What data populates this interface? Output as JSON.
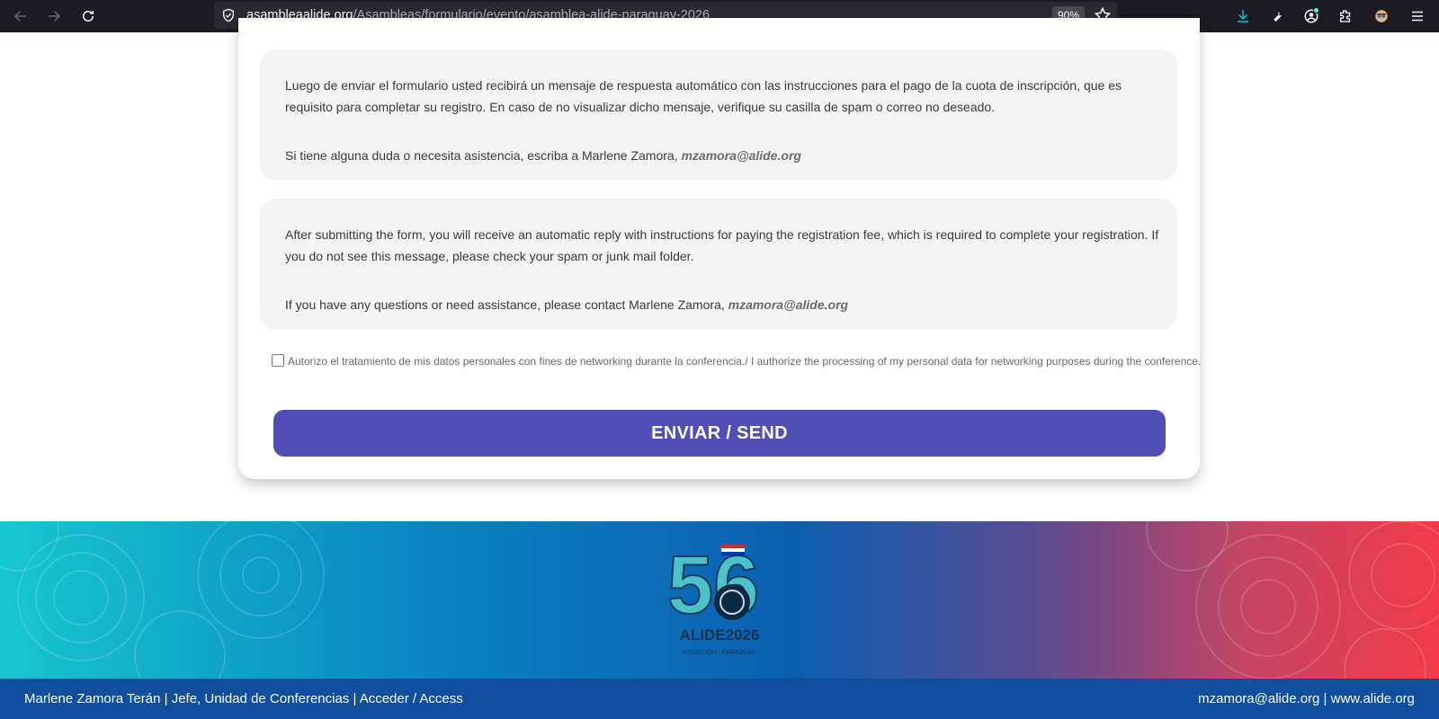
{
  "browser": {
    "url_domain": "asambleaalide.org",
    "url_path": "/Asambleas/formulario/evento/asamblea-alide-paraguay-2026",
    "zoom": "90%"
  },
  "form": {
    "spanish_notice": {
      "paragraph1": "Luego de enviar el formulario usted recibirá un mensaje de respuesta automático con las instrucciones para el pago de la cuota de inscripción, que es requisito para completar su registro. En caso de no visualizar dicho mensaje, verifique su casilla de spam o correo no deseado.",
      "paragraph2_prefix": "Si tiene alguna duda o necesita asistencia, escriba a Marlene Zamora, ",
      "email": "mzamora@alide.org"
    },
    "english_notice": {
      "paragraph1": "After submitting the form, you will receive an automatic reply with instructions for paying the registration fee, which is required to complete your registration. If you do not see this message, please check your spam or junk mail folder.",
      "paragraph2_prefix": "If you have any questions or need assistance, please contact Marlene Zamora, ",
      "email": "mzamora@alide.org"
    },
    "consent_label": "Autorizo el tratamiento de mis datos personales con fines de networking durante la conferencia./ I authorize the processing of my personal data for networking purposes during the conference.",
    "consent_checked": false,
    "submit_label": "ENVIAR / SEND"
  },
  "banner": {
    "logo_number": "56",
    "logo_text": "ALIDE2026",
    "logo_subtext": "ASUNCIÓN - PARAGUAY"
  },
  "footer": {
    "left_text": "Marlene Zamora Terán | Jefe, Unidad de Conferencias | Acceder / Access",
    "right_text": "mzamora@alide.org | www.alide.org"
  },
  "colors": {
    "accent_button": "#4f4fb5",
    "footer_bar": "#0f4f9e",
    "toolbar": "#1c1b22"
  }
}
